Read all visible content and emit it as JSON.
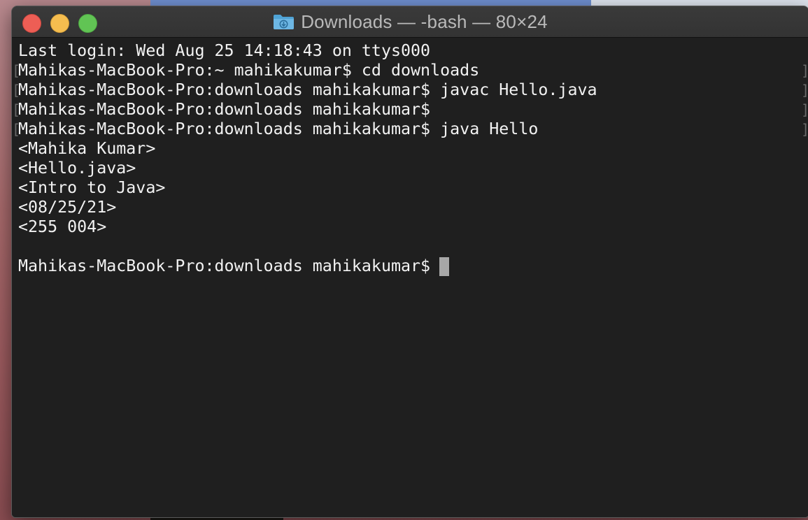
{
  "window": {
    "title": "Downloads — -bash — 80×24",
    "folder_icon": "downloads-folder-icon",
    "traffic_lights": {
      "close": "#ed5e55",
      "minimize": "#f5bd4f",
      "maximize": "#61c454"
    }
  },
  "terminal": {
    "background": "#1f1f1f",
    "text_color": "#f2f2f2",
    "lines": [
      "Last login: Wed Aug 25 14:18:43 on ttys000",
      "Mahikas-MacBook-Pro:~ mahikakumar$ cd downloads",
      "Mahikas-MacBook-Pro:downloads mahikakumar$ javac Hello.java",
      "Mahikas-MacBook-Pro:downloads mahikakumar$",
      "Mahikas-MacBook-Pro:downloads mahikakumar$ java Hello",
      "<Mahika Kumar>",
      "<Hello.java>",
      "<Intro to Java>",
      "<08/25/21>",
      "<255 004>",
      "",
      "Mahikas-MacBook-Pro:downloads mahikakumar$ "
    ],
    "bracket_left": "[",
    "bracket_right": "]"
  }
}
